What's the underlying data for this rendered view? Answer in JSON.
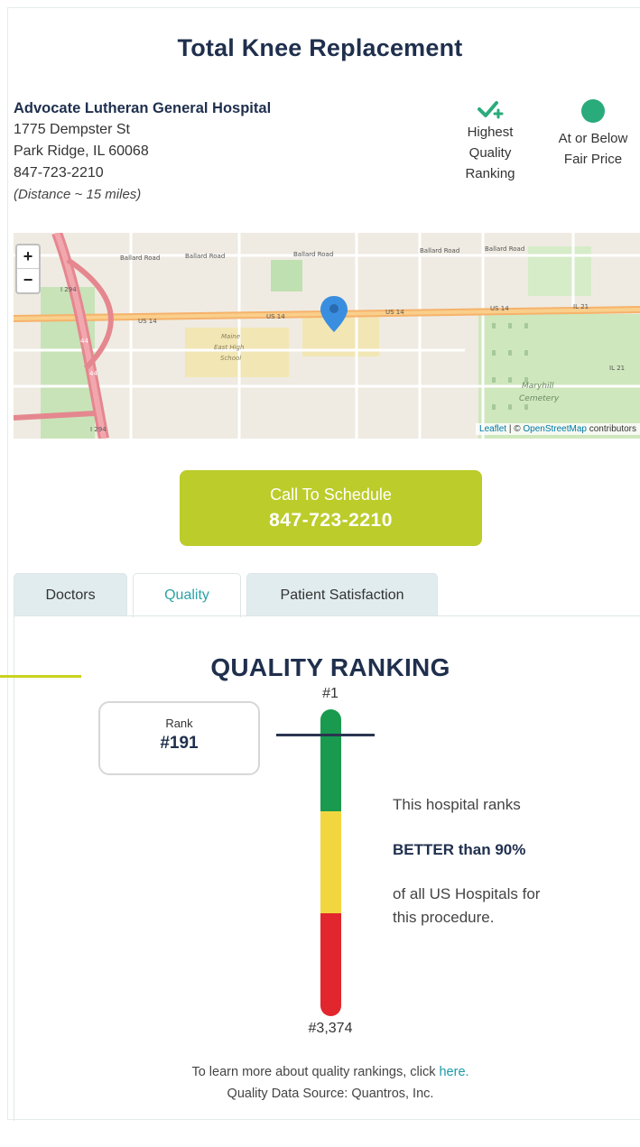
{
  "procedure_title": "Total Knee Replacement",
  "hospital": {
    "name": "Advocate Lutheran General Hospital",
    "street": "1775 Dempster St",
    "city_line": "Park Ridge, IL 60068",
    "phone": "847-723-2210",
    "distance": "(Distance ~ 15 miles)"
  },
  "badges": [
    {
      "icon": "check-plus-icon",
      "label_lines": [
        "Highest",
        "Quality",
        "Ranking"
      ],
      "color": "#2aab7b"
    },
    {
      "icon": "green-dot-icon",
      "label_lines": [
        "At or Below",
        "Fair Price"
      ],
      "color": "#2aab7b"
    }
  ],
  "map": {
    "zoom_in": "+",
    "zoom_out": "−",
    "attribution_leaflet": "Leaflet",
    "attribution_sep": " | © ",
    "attribution_osm": "OpenStreetMap",
    "attribution_tail": " contributors",
    "labels": {
      "ballard1": "Ballard Road",
      "ballard2": "Ballard Road",
      "ballard3": "Ballard Road",
      "ballard4": "Ballard Road",
      "ballard5": "Ballard Road",
      "us14a": "US 14",
      "us14b": "US 14",
      "us14c": "US 14",
      "us14d": "US 14",
      "il21a": "IL 21",
      "il21b": "IL 21",
      "i294a": "I 294",
      "i294b": "I 294",
      "i44a": "44",
      "i44b": "44",
      "school1": "Maine",
      "school2": "East High",
      "school3": "School",
      "cem1": "Maryhill",
      "cem2": "Cemetery"
    }
  },
  "cta": {
    "line1": "Call To Schedule",
    "line2": "847-723-2210",
    "color": "#bccc2a"
  },
  "tabs": [
    {
      "label": "Doctors",
      "active": false
    },
    {
      "label": "Quality",
      "active": true
    },
    {
      "label": "Patient Satisfaction",
      "active": false
    }
  ],
  "quality": {
    "heading": "QUALITY RANKING",
    "top_label": "#1",
    "bottom_label": "#3,374",
    "rank_label": "Rank",
    "rank_value": "#191",
    "rank_number": 191,
    "rank_total": 3374,
    "desc_line1": "This hospital ranks",
    "desc_line2": "BETTER than 90%",
    "desc_line3": "of all US Hospitals for",
    "desc_line4": "this procedure.",
    "bar_colors": {
      "top": "#199a4e",
      "middle": "#f2d640",
      "bottom": "#e1262e"
    }
  },
  "footer": {
    "line1_text": "To learn more about quality rankings, click ",
    "line1_link": "here.",
    "line2": "Quality Data Source: Quantros, Inc."
  }
}
